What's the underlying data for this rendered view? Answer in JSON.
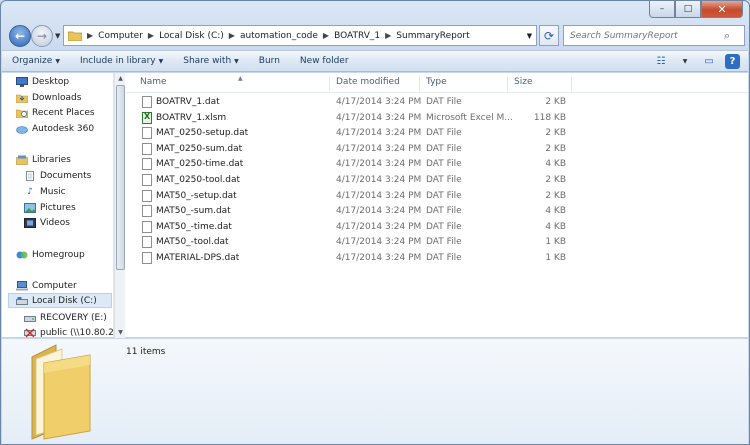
{
  "window": {
    "caption_buttons": {
      "minimize": "–",
      "maximize": "□",
      "close": "✕"
    }
  },
  "address_bar": {
    "crumbs": [
      "Computer",
      "Local Disk (C:)",
      "automation_code",
      "BOATRV_1",
      "SummaryReport"
    ],
    "search_placeholder": "Search SummaryReport"
  },
  "toolbar": {
    "organize": "Organize",
    "include_in_library": "Include in library",
    "share_with": "Share with",
    "burn": "Burn",
    "new_folder": "New folder"
  },
  "nav_pane": {
    "favorites": [
      {
        "label": "Desktop",
        "icon": "desktop-icon"
      },
      {
        "label": "Downloads",
        "icon": "downloads-icon"
      },
      {
        "label": "Recent Places",
        "icon": "recent-places-icon"
      },
      {
        "label": "Autodesk 360",
        "icon": "cloud-icon"
      }
    ],
    "libraries_label": "Libraries",
    "libraries": [
      {
        "label": "Documents",
        "icon": "documents-icon"
      },
      {
        "label": "Music",
        "icon": "music-icon"
      },
      {
        "label": "Pictures",
        "icon": "pictures-icon"
      },
      {
        "label": "Videos",
        "icon": "videos-icon"
      }
    ],
    "homegroup_label": "Homegroup",
    "computer_label": "Computer",
    "computer_items": [
      {
        "label": "Local Disk (C:)",
        "icon": "drive-icon",
        "selected": true
      },
      {
        "label": "RECOVERY (E:)",
        "icon": "drive-icon"
      },
      {
        "label": "public (\\\\10.80.22",
        "icon": "network-drive-icon"
      }
    ]
  },
  "columns": {
    "name": "Name",
    "date": "Date modified",
    "type": "Type",
    "size": "Size"
  },
  "files": [
    {
      "name": "BOATRV_1.dat",
      "date": "4/17/2014 3:24 PM",
      "type": "DAT File",
      "size": "2 KB",
      "kind": "dat"
    },
    {
      "name": "BOATRV_1.xlsm",
      "date": "4/17/2014 3:24 PM",
      "type": "Microsoft Excel M...",
      "size": "118 KB",
      "kind": "excel"
    },
    {
      "name": "MAT_0250-setup.dat",
      "date": "4/17/2014 3:24 PM",
      "type": "DAT File",
      "size": "2 KB",
      "kind": "dat"
    },
    {
      "name": "MAT_0250-sum.dat",
      "date": "4/17/2014 3:24 PM",
      "type": "DAT File",
      "size": "2 KB",
      "kind": "dat"
    },
    {
      "name": "MAT_0250-time.dat",
      "date": "4/17/2014 3:24 PM",
      "type": "DAT File",
      "size": "4 KB",
      "kind": "dat"
    },
    {
      "name": "MAT_0250-tool.dat",
      "date": "4/17/2014 3:24 PM",
      "type": "DAT File",
      "size": "2 KB",
      "kind": "dat"
    },
    {
      "name": "MAT50_-setup.dat",
      "date": "4/17/2014 3:24 PM",
      "type": "DAT File",
      "size": "2 KB",
      "kind": "dat"
    },
    {
      "name": "MAT50_-sum.dat",
      "date": "4/17/2014 3:24 PM",
      "type": "DAT File",
      "size": "4 KB",
      "kind": "dat"
    },
    {
      "name": "MAT50_-time.dat",
      "date": "4/17/2014 3:24 PM",
      "type": "DAT File",
      "size": "4 KB",
      "kind": "dat"
    },
    {
      "name": "MAT50_-tool.dat",
      "date": "4/17/2014 3:24 PM",
      "type": "DAT File",
      "size": "1 KB",
      "kind": "dat"
    },
    {
      "name": "MATERIAL-DPS.dat",
      "date": "4/17/2014 3:24 PM",
      "type": "DAT File",
      "size": "1 KB",
      "kind": "dat"
    }
  ],
  "details": {
    "items_count": "11 items"
  }
}
